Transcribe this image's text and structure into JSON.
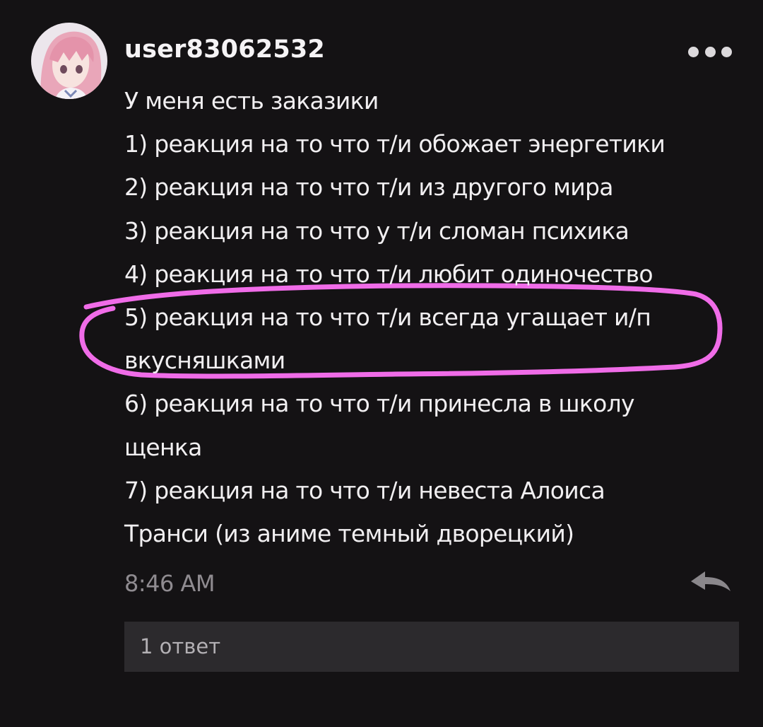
{
  "comment": {
    "username": "user83062532",
    "avatar_icon": "anime-avatar-icon",
    "lines": [
      "У меня есть заказики",
      "1) реакция на то что т/и обожает энергетики",
      "2) реакция на то что т/и из другого мира",
      "3) реакция на то что у т/и сломан психика",
      "4) реакция на то что т/и любит одиночество",
      "5) реакция на то что т/и всегда угащает и/п",
      "вкусняшками",
      "6) реакция на то что т/и принесла в школу",
      "щенка",
      "7) реакция на то что т/и невеста Алоиса",
      "Транси (из аниме темный дворецкий)"
    ],
    "time": "8:46 AM",
    "replies_label": "1 ответ"
  },
  "icons": {
    "more": "more-options-icon",
    "reply": "reply-arrow-icon"
  },
  "colors": {
    "background": "#141214",
    "text": "#f1eff1",
    "muted": "#8f8b90",
    "annotation": "#f06ce8",
    "replies_bar": "#2c2a2d"
  }
}
